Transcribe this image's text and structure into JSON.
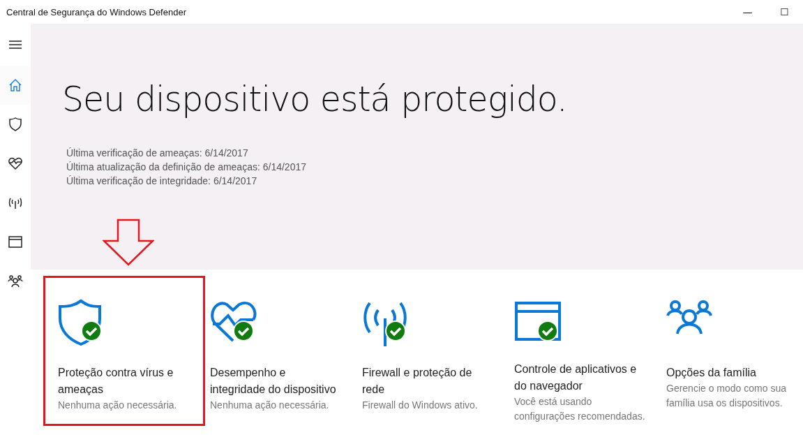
{
  "window": {
    "title": "Central de Segurança do Windows Defender",
    "controls": [
      "—",
      "☐"
    ]
  },
  "sidebar": {
    "items": [
      {
        "kind": "menu",
        "selected": false
      },
      {
        "kind": "home",
        "selected": true
      },
      {
        "kind": "shield",
        "selected": false
      },
      {
        "kind": "heart",
        "selected": false
      },
      {
        "kind": "antenna",
        "selected": false
      },
      {
        "kind": "browser",
        "selected": false
      },
      {
        "kind": "family",
        "selected": false
      }
    ]
  },
  "hero": {
    "heading": "Seu dispositivo está protegido.",
    "details": [
      "Última verificação de ameaças: 6/14/2017",
      "Última atualização da definição de ameaças: 6/14/2017",
      "Última verificação de integridade: 6/14/2017"
    ]
  },
  "tiles": [
    {
      "kind": "shield",
      "ok": true,
      "highlighted": true,
      "title": "Proteção contra vírus e ameaças",
      "status": "Nenhuma ação necessária."
    },
    {
      "kind": "heart",
      "ok": true,
      "highlighted": false,
      "title": "Desempenho e integridade do dispositivo",
      "status": "Nenhuma ação necessária."
    },
    {
      "kind": "antenna",
      "ok": true,
      "highlighted": false,
      "title": "Firewall e proteção de rede",
      "status": "Firewall do Windows ativo."
    },
    {
      "kind": "browser",
      "ok": true,
      "highlighted": false,
      "title": "Controle de aplicativos e do navegador",
      "status": "Você está usando configurações recomendadas."
    },
    {
      "kind": "family",
      "ok": false,
      "highlighted": false,
      "title": "Opções da família",
      "status": "Gerencie o modo como sua família usa os dispositivos."
    }
  ]
}
